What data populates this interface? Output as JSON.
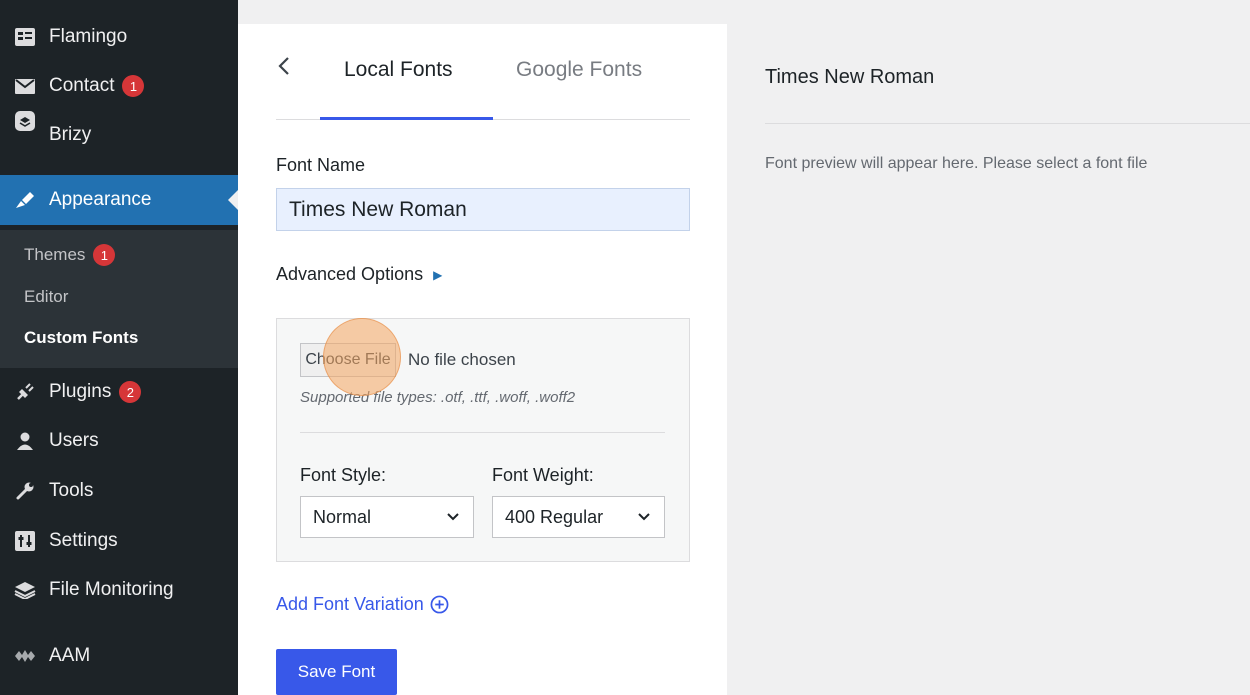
{
  "sidebar": {
    "items": [
      {
        "label": "Flamingo",
        "icon": "flamingo-icon"
      },
      {
        "label": "Contact",
        "icon": "mail-icon",
        "badge": "1"
      },
      {
        "label": "Brizy",
        "icon": "brizy-icon"
      },
      {
        "label": "Appearance",
        "icon": "brush-icon",
        "active": true
      },
      {
        "label": "Plugins",
        "icon": "plugin-icon",
        "badge": "2"
      },
      {
        "label": "Users",
        "icon": "users-icon"
      },
      {
        "label": "Tools",
        "icon": "wrench-icon"
      },
      {
        "label": "Settings",
        "icon": "settings-icon"
      },
      {
        "label": "File Monitoring",
        "icon": "layers-icon"
      },
      {
        "label": "AAM",
        "icon": "aam-icon"
      }
    ],
    "submenu": [
      {
        "label": "Themes",
        "badge": "1"
      },
      {
        "label": "Editor"
      },
      {
        "label": "Custom Fonts",
        "current": true
      }
    ]
  },
  "tabs": {
    "local": "Local Fonts",
    "google": "Google Fonts"
  },
  "form": {
    "font_name_label": "Font Name",
    "font_name_value": "Times New Roman",
    "advanced_label": "Advanced Options",
    "choose_file": "Choose File",
    "file_status": "No file chosen",
    "hint": "Supported file types: .otf, .ttf, .woff, .woff2",
    "style_label": "Font Style:",
    "style_value": "Normal",
    "weight_label": "Font Weight:",
    "weight_value": "400 Regular",
    "add_variation": "Add Font Variation",
    "save": "Save Font"
  },
  "preview": {
    "title": "Times New Roman",
    "placeholder": "Font preview will appear here. Please select a font file"
  },
  "colors": {
    "sidebar_bg": "#1d2327",
    "accent": "#3858e9",
    "active_menu": "#2271b1",
    "badge": "#d63638"
  }
}
